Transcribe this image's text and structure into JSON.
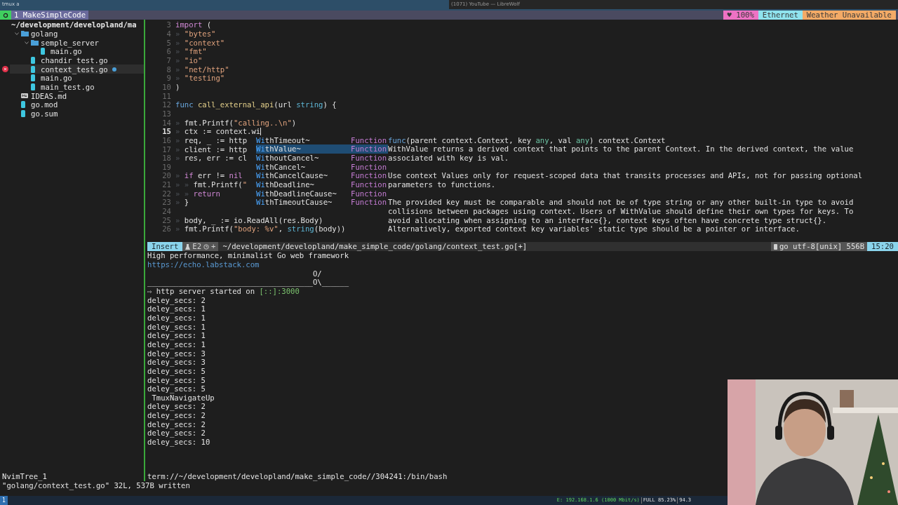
{
  "os_bar": {
    "left_title": "tmux a",
    "right_title": "(1071) YouTube — LibreWolf"
  },
  "tmux_top": {
    "tabs": [
      {
        "label": "1 MakeSimpleCode",
        "selected": true
      }
    ],
    "segments": [
      {
        "text": "♥ 100%",
        "color": "#ee72c4"
      },
      {
        "text": "Ethernet",
        "color": "#8fe3ee"
      },
      {
        "text": "Weather Unavailable",
        "color": "#f3aa66"
      }
    ]
  },
  "tree": {
    "root": "~/development/developland/ma",
    "items": [
      {
        "name": "golang",
        "kind": "folder",
        "expanded": true,
        "selected": false,
        "error": false,
        "modified": false,
        "children": [
          {
            "name": "semple_server",
            "kind": "folder",
            "expanded": true,
            "selected": false,
            "error": false,
            "modified": false,
            "children": [
              {
                "name": "main.go",
                "kind": "go",
                "selected": false,
                "error": false,
                "modified": false
              }
            ]
          },
          {
            "name": "chandir_test.go",
            "kind": "go",
            "selected": false,
            "error": false,
            "modified": false
          },
          {
            "name": "context_test.go",
            "kind": "go",
            "selected": true,
            "error": true,
            "modified": true
          },
          {
            "name": "main.go",
            "kind": "go",
            "selected": false,
            "error": false,
            "modified": false
          },
          {
            "name": "main_test.go",
            "kind": "go",
            "selected": false,
            "error": false,
            "modified": false
          }
        ]
      },
      {
        "name": "IDEAS.md",
        "kind": "markdown",
        "selected": false,
        "error": false,
        "modified": false
      },
      {
        "name": "go.mod",
        "kind": "go",
        "selected": false,
        "error": false,
        "modified": false
      },
      {
        "name": "go.sum",
        "kind": "go",
        "selected": false,
        "error": false,
        "modified": false
      }
    ],
    "window_label": "NvimTree_1"
  },
  "editor": {
    "lines": [
      {
        "number": "3",
        "current": false,
        "tokens": [
          {
            "kind": "keyword",
            "text": "import"
          },
          {
            "kind": "plain",
            "text": " ("
          }
        ]
      },
      {
        "number": "4",
        "current": false,
        "tokens": [
          {
            "kind": "guide",
            "text": "» "
          },
          {
            "kind": "string",
            "text": "\"bytes\""
          }
        ]
      },
      {
        "number": "5",
        "current": false,
        "tokens": [
          {
            "kind": "guide",
            "text": "» "
          },
          {
            "kind": "string",
            "text": "\"context\""
          }
        ]
      },
      {
        "number": "6",
        "current": false,
        "tokens": [
          {
            "kind": "guide",
            "text": "» "
          },
          {
            "kind": "string",
            "text": "\"fmt\""
          }
        ]
      },
      {
        "number": "7",
        "current": false,
        "tokens": [
          {
            "kind": "guide",
            "text": "» "
          },
          {
            "kind": "string",
            "text": "\"io\""
          }
        ]
      },
      {
        "number": "8",
        "current": false,
        "tokens": [
          {
            "kind": "guide",
            "text": "» "
          },
          {
            "kind": "string",
            "text": "\"net/http\""
          }
        ]
      },
      {
        "number": "9",
        "current": false,
        "tokens": [
          {
            "kind": "guide",
            "text": "» "
          },
          {
            "kind": "string",
            "text": "\"testing\""
          }
        ]
      },
      {
        "number": "10",
        "current": false,
        "tokens": [
          {
            "kind": "plain",
            "text": ")"
          }
        ]
      },
      {
        "number": "11",
        "current": false
      },
      {
        "number": "12",
        "current": false,
        "tokens": [
          {
            "kind": "declare",
            "text": "func"
          },
          {
            "kind": "function",
            "text": " call_external_api"
          },
          {
            "kind": "plain",
            "text": "(url "
          },
          {
            "kind": "type",
            "text": "string"
          },
          {
            "kind": "plain",
            "text": ") {"
          }
        ]
      },
      {
        "number": "13",
        "current": false
      },
      {
        "number": "14",
        "current": false,
        "tokens": [
          {
            "kind": "guide",
            "text": "» "
          },
          {
            "kind": "plain",
            "text": "fmt.Printf("
          },
          {
            "kind": "string",
            "text": "\"calling..\\n\""
          },
          {
            "kind": "plain",
            "text": ")"
          }
        ]
      },
      {
        "number": "15",
        "current": true,
        "tokens": [
          {
            "kind": "guide",
            "text": "» "
          },
          {
            "kind": "plain",
            "text": "ctx := context.wi"
          }
        ]
      },
      {
        "number": "16",
        "current": false,
        "tokens": [
          {
            "kind": "guide",
            "text": "» "
          },
          {
            "kind": "plain",
            "text": "req, _ := http"
          }
        ]
      },
      {
        "number": "17",
        "current": false,
        "tokens": [
          {
            "kind": "guide",
            "text": "» "
          },
          {
            "kind": "plain",
            "text": "client := http"
          }
        ]
      },
      {
        "number": "18",
        "current": false,
        "tokens": [
          {
            "kind": "guide",
            "text": "» "
          },
          {
            "kind": "plain",
            "text": "res, err := cl"
          }
        ]
      },
      {
        "number": "19",
        "current": false
      },
      {
        "number": "20",
        "current": false,
        "tokens": [
          {
            "kind": "guide",
            "text": "» "
          },
          {
            "kind": "keyword",
            "text": "if"
          },
          {
            "kind": "plain",
            "text": " err != "
          },
          {
            "kind": "keyword",
            "text": "nil"
          }
        ]
      },
      {
        "number": "21",
        "current": false,
        "tokens": [
          {
            "kind": "guide",
            "text": "» » "
          },
          {
            "kind": "plain",
            "text": "fmt.Printf("
          },
          {
            "kind": "string",
            "text": "\""
          }
        ]
      },
      {
        "number": "22",
        "current": false,
        "tokens": [
          {
            "kind": "guide",
            "text": "» » "
          },
          {
            "kind": "keyword",
            "text": "return"
          }
        ]
      },
      {
        "number": "23",
        "current": false,
        "tokens": [
          {
            "kind": "guide",
            "text": "» "
          },
          {
            "kind": "plain",
            "text": "}"
          }
        ]
      },
      {
        "number": "24",
        "current": false
      },
      {
        "number": "25",
        "current": false,
        "tokens": [
          {
            "kind": "guide",
            "text": "» "
          },
          {
            "kind": "plain",
            "text": "body, _ := io.ReadAll(res.Body)"
          }
        ]
      },
      {
        "number": "26",
        "current": false,
        "tokens": [
          {
            "kind": "guide",
            "text": "» "
          },
          {
            "kind": "plain",
            "text": "fmt.Printf("
          },
          {
            "kind": "string",
            "text": "\"body: %v\""
          },
          {
            "kind": "plain",
            "text": ", "
          },
          {
            "kind": "type",
            "text": "string"
          },
          {
            "kind": "plain",
            "text": "(body))"
          }
        ]
      }
    ],
    "completion": {
      "items": [
        {
          "match": "Wi",
          "rest": "thTimeout~",
          "kind_label": "Function",
          "selected": false
        },
        {
          "match": "Wi",
          "rest": "thValue~",
          "kind_label": "Function",
          "selected": true
        },
        {
          "match": "Wi",
          "rest": "thoutCancel~",
          "kind_label": "Function",
          "selected": false
        },
        {
          "match": "Wi",
          "rest": "thCancel~",
          "kind_label": "Function",
          "selected": false
        },
        {
          "match": "Wi",
          "rest": "thCancelCause~",
          "kind_label": "Function",
          "selected": false
        },
        {
          "match": "Wi",
          "rest": "thDeadline~",
          "kind_label": "Function",
          "selected": false
        },
        {
          "match": "Wi",
          "rest": "thDeadlineCause~",
          "kind_label": "Function",
          "selected": false
        },
        {
          "match": "Wi",
          "rest": "thTimeoutCause~",
          "kind_label": "Function",
          "selected": false
        }
      ],
      "doc": {
        "signature": [
          {
            "kind": "declare",
            "text": "func"
          },
          {
            "kind": "plain",
            "text": "(parent context.Context, key "
          },
          {
            "kind": "builtin",
            "text": "any"
          },
          {
            "kind": "plain",
            "text": ", val "
          },
          {
            "kind": "builtin",
            "text": "any"
          },
          {
            "kind": "plain",
            "text": ") context.Context"
          }
        ],
        "paragraphs": [
          [
            "WithValue returns a derived context that points to the parent Context. In the derived context, the value",
            "associated with key is val."
          ],
          [
            "Use context Values only for request-scoped data that transits processes and APIs, not for passing optional",
            "parameters to functions."
          ],
          [
            "The provided key must be comparable and should not be of type string or any other built-in type to avoid",
            "collisions between packages using context. Users of WithValue should define their own types for keys. To",
            "avoid allocating when assigning to an interface{}, context keys often have concrete type struct{}.",
            "Alternatively, exported context key variables' static type should be a pointer or interface."
          ]
        ]
      }
    }
  },
  "status_line": {
    "mode": "Insert",
    "diagnostics": "E2",
    "changes": "+",
    "path": "~/development/developland/make_simple_code/golang/context_test.go[+]",
    "file_info": "go utf-8[unix] 556B",
    "time": "15:20"
  },
  "terminal": {
    "lines": [
      {
        "tokens": [
          {
            "kind": "plain",
            "text": "High performance, minimalist Go web framework"
          }
        ]
      },
      {
        "tokens": [
          {
            "kind": "link",
            "text": "https://echo.labstack.com"
          }
        ]
      },
      {
        "tokens": [
          {
            "kind": "plain",
            "text": "                                     O/"
          }
        ]
      },
      {
        "tokens": [
          {
            "kind": "plain",
            "text": "_____________________________________O\\______"
          }
        ]
      },
      {
        "tokens": [
          {
            "kind": "plain",
            "text": "⇨ http server started on "
          },
          {
            "kind": "accent",
            "text": "[::]:3000"
          }
        ]
      },
      {
        "tokens": [
          {
            "kind": "plain",
            "text": "deley_secs: 2"
          }
        ]
      },
      {
        "tokens": [
          {
            "kind": "plain",
            "text": "deley_secs: 1"
          }
        ]
      },
      {
        "tokens": [
          {
            "kind": "plain",
            "text": "deley_secs: 1"
          }
        ]
      },
      {
        "tokens": [
          {
            "kind": "plain",
            "text": "deley_secs: 1"
          }
        ]
      },
      {
        "tokens": [
          {
            "kind": "plain",
            "text": "deley_secs: 1"
          }
        ]
      },
      {
        "tokens": [
          {
            "kind": "plain",
            "text": "deley_secs: 1"
          }
        ]
      },
      {
        "tokens": [
          {
            "kind": "plain",
            "text": "deley_secs: 3"
          }
        ]
      },
      {
        "tokens": [
          {
            "kind": "plain",
            "text": "deley_secs: 3"
          }
        ]
      },
      {
        "tokens": [
          {
            "kind": "plain",
            "text": "deley_secs: 5"
          }
        ]
      },
      {
        "tokens": [
          {
            "kind": "plain",
            "text": "deley_secs: 5"
          }
        ]
      },
      {
        "tokens": [
          {
            "kind": "plain",
            "text": "deley_secs: 5"
          }
        ]
      },
      {
        "tokens": [
          {
            "kind": "plain",
            "text": " TmuxNavigateUp"
          }
        ]
      },
      {
        "tokens": [
          {
            "kind": "plain",
            "text": "deley_secs: 2"
          }
        ]
      },
      {
        "tokens": [
          {
            "kind": "plain",
            "text": "deley_secs: 2"
          }
        ]
      },
      {
        "tokens": [
          {
            "kind": "plain",
            "text": "deley_secs: 2"
          }
        ]
      },
      {
        "tokens": [
          {
            "kind": "plain",
            "text": "deley_secs: 2"
          }
        ]
      },
      {
        "tokens": [
          {
            "kind": "plain",
            "text": "deley_secs: 10"
          }
        ]
      }
    ],
    "window_label": "term://~/development/developland/make_simple_code//304241:/bin/bash"
  },
  "message": "\"golang/context_test.go\" 32L, 537B written",
  "tmux_bottom": {
    "window": "1",
    "segments": [
      {
        "text": "E: 192.168.1.6 (1000 Mbit/s)",
        "kind": "network"
      },
      {
        "text": "FULL 85.23%",
        "kind": "plain"
      },
      {
        "text": "94.3",
        "kind": "plain"
      }
    ]
  }
}
